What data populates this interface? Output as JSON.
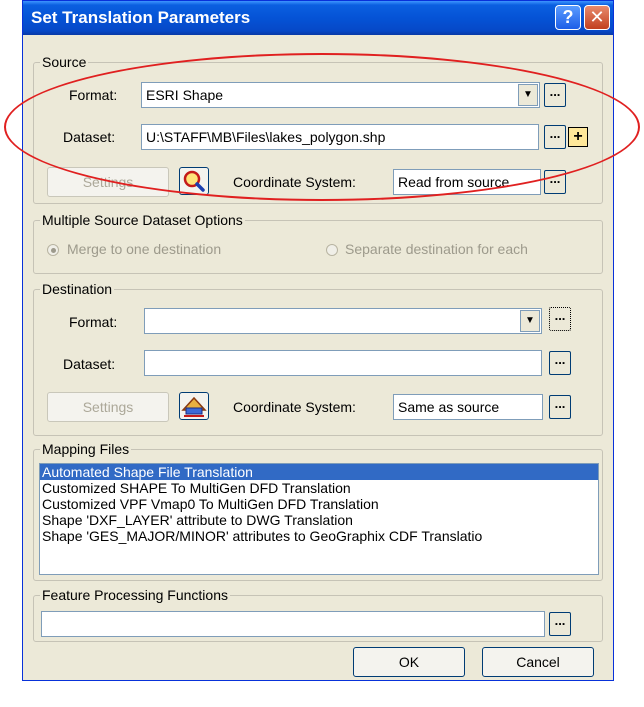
{
  "window": {
    "title": "Set Translation Parameters",
    "help_glyph": "?",
    "close_glyph": "✕"
  },
  "source": {
    "legend": "Source",
    "format_label": "Format:",
    "format_value": "ESRI Shape",
    "dataset_label": "Dataset:",
    "dataset_value": "U:\\STAFF\\MB\\Files\\lakes_polygon.shp",
    "settings_label": "Settings",
    "coord_label": "Coordinate System:",
    "coord_value": "Read from source"
  },
  "multi": {
    "legend": "Multiple Source Dataset Options",
    "merge_label": "Merge to one destination",
    "separate_label": "Separate destination for each",
    "selected": "merge"
  },
  "destination": {
    "legend": "Destination",
    "format_label": "Format:",
    "format_value": "",
    "dataset_label": "Dataset:",
    "dataset_value": "",
    "settings_label": "Settings",
    "coord_label": "Coordinate System:",
    "coord_value": "Same as source"
  },
  "mapping": {
    "legend": "Mapping Files",
    "items": [
      "Automated Shape File Translation",
      "Customized SHAPE To MultiGen DFD Translation",
      "Customized VPF Vmap0 To MultiGen DFD Translation",
      "Shape 'DXF_LAYER' attribute to DWG Translation",
      "Shape 'GES_MAJOR/MINOR' attributes to GeoGraphix CDF Translatio"
    ],
    "selected_index": 0
  },
  "fpf": {
    "legend": "Feature Processing Functions",
    "value": ""
  },
  "buttons": {
    "ok": "OK",
    "cancel": "Cancel",
    "dots": "...",
    "arrow": "▼",
    "plus": "+"
  },
  "colors": {
    "titlebar": "#0553d6",
    "dialog_bg": "#ece9d8",
    "selection": "#316ac5",
    "annotation": "#e02020"
  }
}
